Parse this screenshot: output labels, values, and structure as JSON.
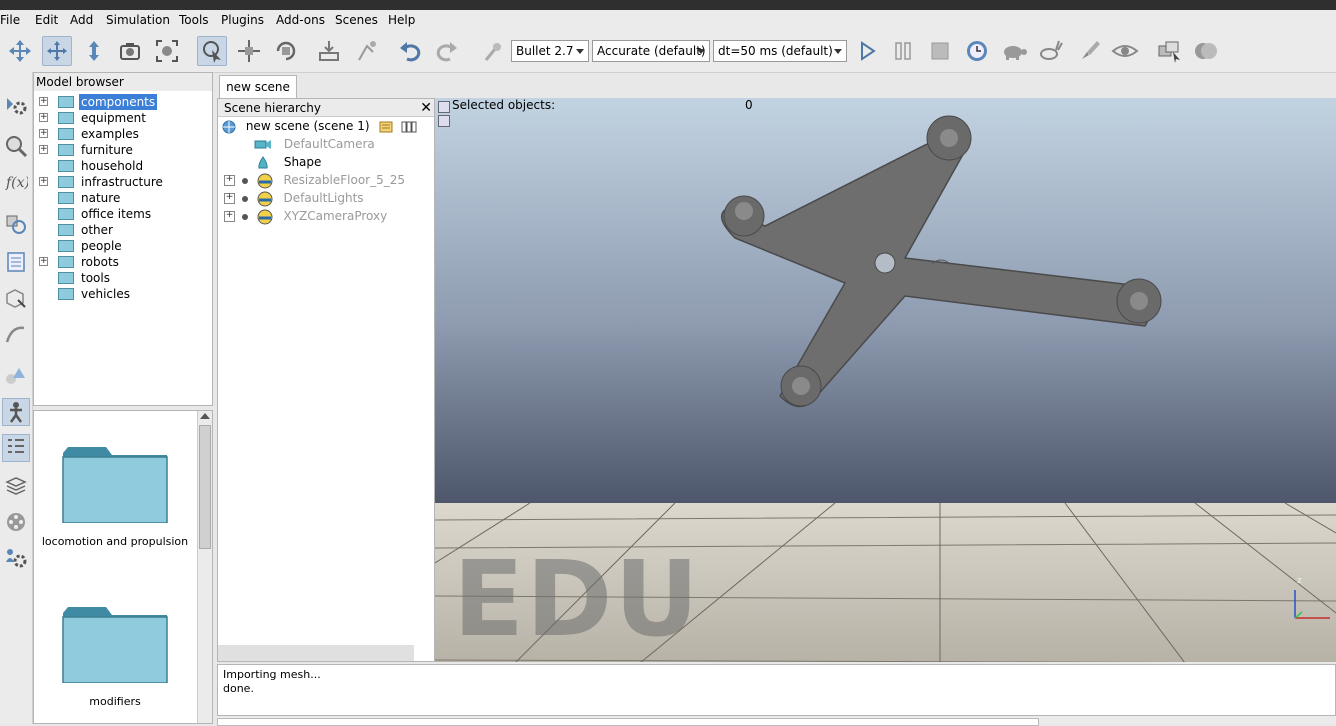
{
  "menu": [
    "File",
    "Edit",
    "Add",
    "Simulation",
    "Tools",
    "Plugins",
    "Add-ons",
    "Scenes",
    "Help"
  ],
  "toolbar": {
    "engine": "Bullet 2.7",
    "accuracy": "Accurate (default)",
    "timestep": "dt=50 ms (default)"
  },
  "model_browser": {
    "title": "Model browser",
    "items": [
      {
        "label": "components",
        "expandable": true,
        "selected": true
      },
      {
        "label": "equipment",
        "expandable": true
      },
      {
        "label": "examples",
        "expandable": true
      },
      {
        "label": "furniture",
        "expandable": true
      },
      {
        "label": "household",
        "expandable": false
      },
      {
        "label": "infrastructure",
        "expandable": true
      },
      {
        "label": "nature",
        "expandable": false
      },
      {
        "label": "office items",
        "expandable": false
      },
      {
        "label": "other",
        "expandable": false
      },
      {
        "label": "people",
        "expandable": false
      },
      {
        "label": "robots",
        "expandable": true
      },
      {
        "label": "tools",
        "expandable": false
      },
      {
        "label": "vehicles",
        "expandable": false
      }
    ],
    "thumbnails": [
      "locomotion and propulsion",
      "modifiers"
    ]
  },
  "scene": {
    "tab": "new scene",
    "hierarchy_title": "Scene hierarchy",
    "root": "new scene (scene 1)",
    "objects": [
      "DefaultCamera",
      "Shape",
      "ResizableFloor_5_25",
      "DefaultLights",
      "XYZCameraProxy"
    ]
  },
  "viewport": {
    "selected_label": "Selected objects:",
    "selected_count": "0",
    "watermark": "EDU",
    "axis_z": "z",
    "axis_y": "y",
    "axis_x": "x"
  },
  "console": {
    "line1": "Importing mesh...",
    "line2": "done."
  },
  "colors": {
    "selection": "#3b7fd9",
    "folder": "#8ecbdc",
    "shape": "#6e6e6e"
  }
}
